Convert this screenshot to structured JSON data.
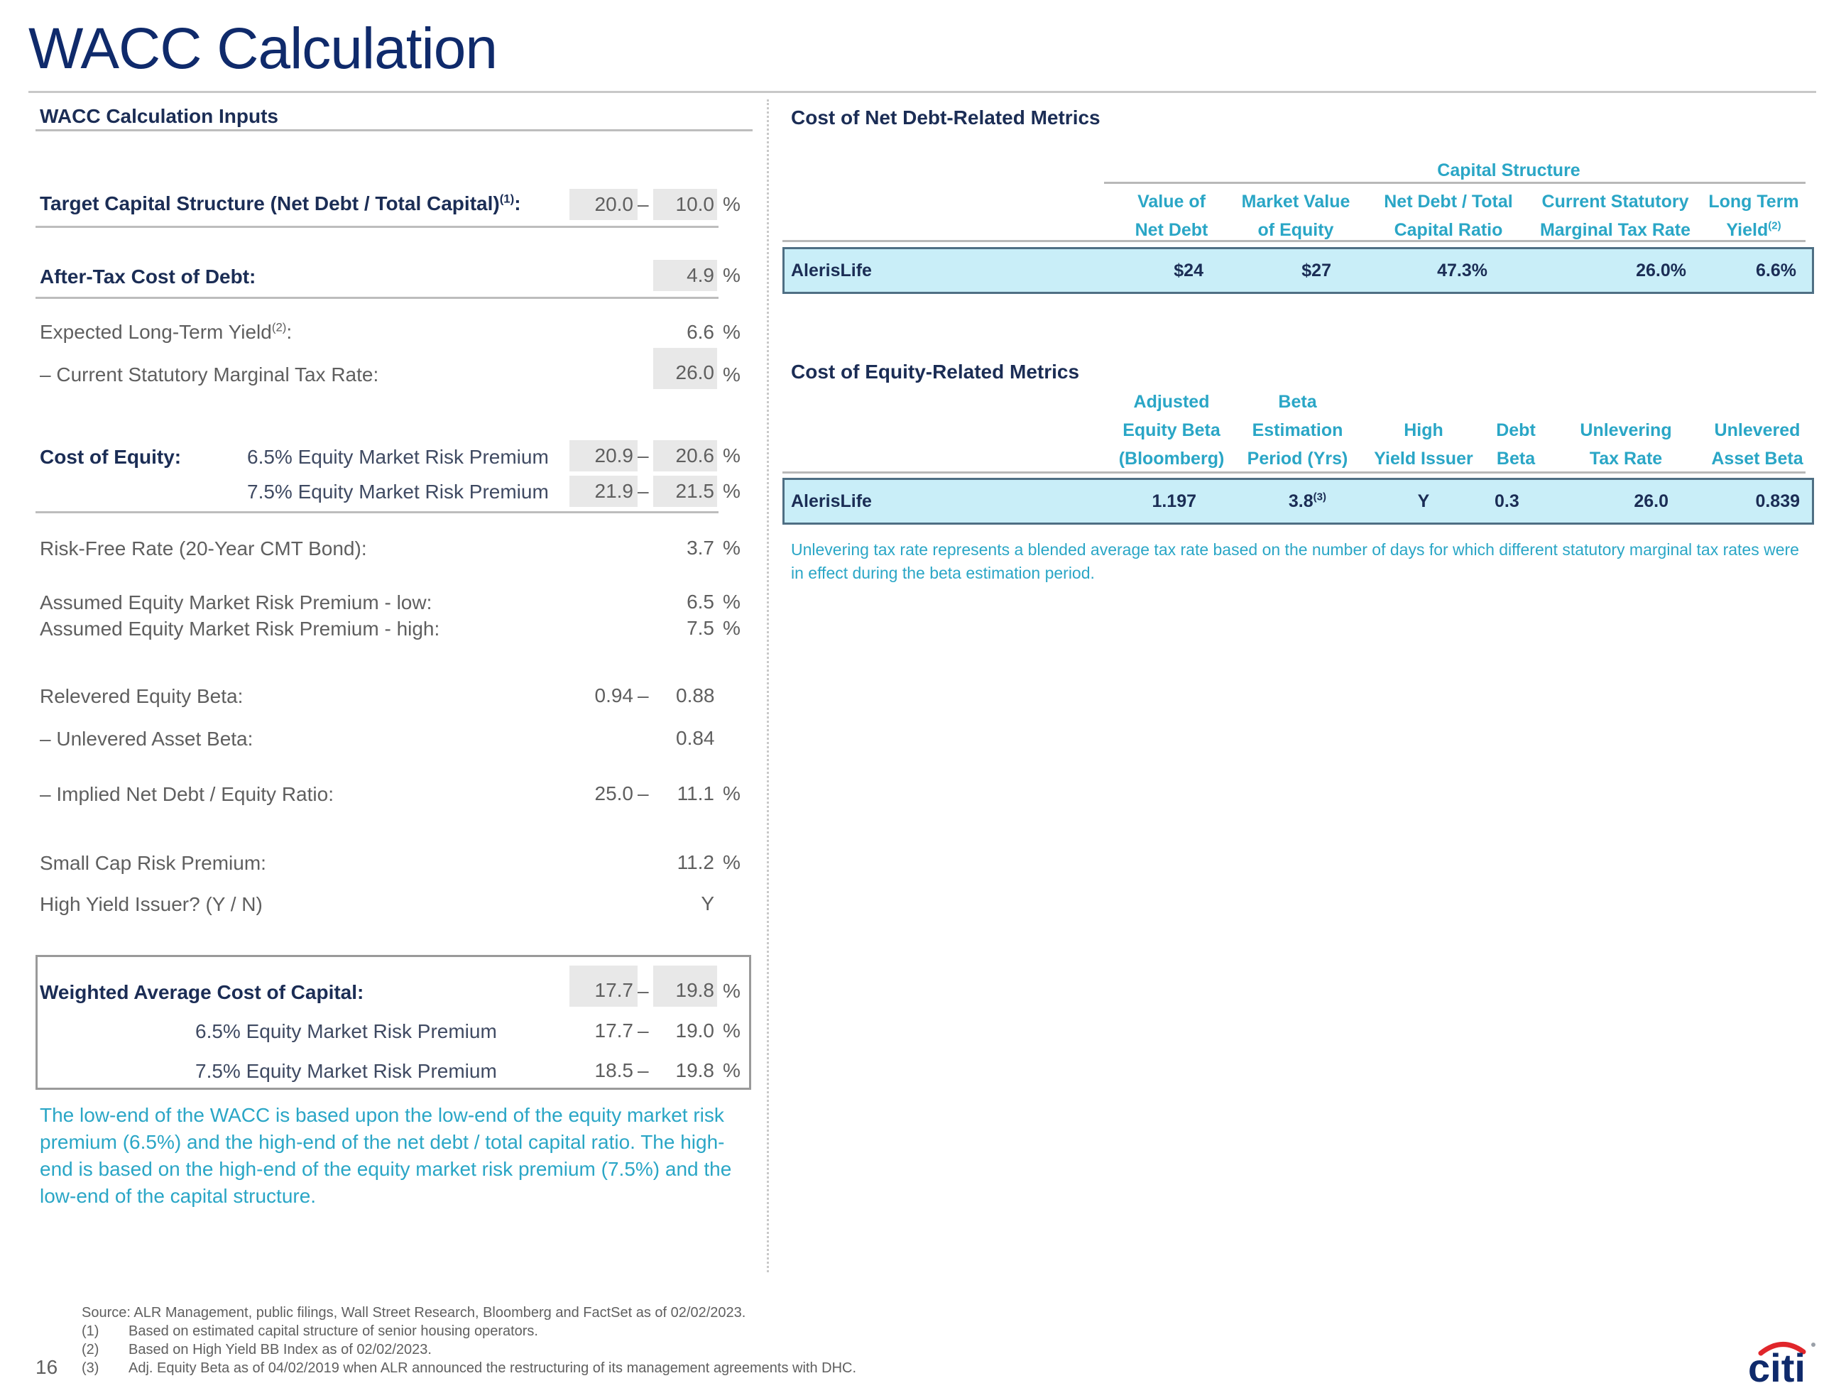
{
  "page": {
    "title": "WACC Calculation",
    "page_number": "16"
  },
  "inputs": {
    "section_title": "WACC Calculation Inputs",
    "target_capital": {
      "label": "Target Capital Structure (Net Debt / Total Capital)",
      "footnote": "(1)",
      "suffix": ":",
      "low": "20.0",
      "high": "10.0",
      "unit": "%"
    },
    "after_tax_cost_of_debt": {
      "label": "After-Tax Cost of Debt:",
      "value": "4.9",
      "unit": "%"
    },
    "expected_yield": {
      "label": "Expected Long-Term Yield",
      "footnote": "(2)",
      "suffix": ":",
      "value": "6.6",
      "unit": "%"
    },
    "marginal_tax": {
      "label": "– Current Statutory Marginal Tax Rate:",
      "value": "26.0",
      "unit": "%"
    },
    "cost_of_equity": {
      "label": "Cost of Equity:",
      "rows": [
        {
          "label": "6.5% Equity Market Risk Premium",
          "low": "20.9",
          "high": "20.6",
          "unit": "%"
        },
        {
          "label": "7.5% Equity Market Risk Premium",
          "low": "21.9",
          "high": "21.5",
          "unit": "%"
        }
      ]
    },
    "risk_free": {
      "label": "Risk-Free Rate (20-Year CMT Bond):",
      "value": "3.7",
      "unit": "%"
    },
    "erp_low": {
      "label": "Assumed Equity Market Risk Premium - low:",
      "value": "6.5",
      "unit": "%"
    },
    "erp_high": {
      "label": "Assumed Equity Market Risk Premium - high:",
      "value": "7.5",
      "unit": "%"
    },
    "relevered_beta": {
      "label": "Relevered Equity Beta:",
      "low": "0.94",
      "high": "0.88"
    },
    "unlevered_beta": {
      "label": "– Unlevered Asset Beta:",
      "value": "0.84"
    },
    "implied_ratio": {
      "label": "– Implied Net Debt / Equity Ratio:",
      "low": "25.0",
      "high": "11.1",
      "unit": "%"
    },
    "small_cap": {
      "label": "Small Cap Risk Premium:",
      "value": "11.2",
      "unit": "%"
    },
    "high_yield": {
      "label": "High Yield Issuer? (Y / N)",
      "value": "Y"
    },
    "dash": "–"
  },
  "wacc": {
    "label": "Weighted Average Cost of Capital:",
    "low": "17.7",
    "high": "19.8",
    "unit": "%",
    "rows": [
      {
        "label": "6.5% Equity Market Risk Premium",
        "low": "17.7",
        "high": "19.0",
        "unit": "%"
      },
      {
        "label": "7.5% Equity Market Risk Premium",
        "low": "18.5",
        "high": "19.8",
        "unit": "%"
      }
    ],
    "note": "The low-end of the WACC is based upon the low-end of the equity market risk premium (6.5%) and the high-end of the net debt / total capital ratio. The high-end is based on the high-end of the equity market risk premium (7.5%) and the low-end of the capital structure."
  },
  "debt_metrics": {
    "section_title": "Cost of Net Debt-Related Metrics",
    "group_header": "Capital Structure",
    "columns": [
      {
        "line1": "Value of",
        "line2": "Net Debt"
      },
      {
        "line1": "Market Value",
        "line2": "of Equity"
      },
      {
        "line1": "Net Debt / Total",
        "line2": "Capital Ratio"
      },
      {
        "line1": "Current Statutory",
        "line2": "Marginal Tax Rate"
      },
      {
        "line1": "Long Term",
        "line2": "Yield",
        "footnote": "(2)"
      }
    ],
    "row": {
      "name": "AlerisLife",
      "values": [
        "$24",
        "$27",
        "47.3%",
        "26.0%",
        "6.6%"
      ]
    }
  },
  "equity_metrics": {
    "section_title": "Cost of Equity-Related Metrics",
    "columns": [
      {
        "line1": "Adjusted",
        "line2": "Equity Beta",
        "line3": "(Bloomberg)"
      },
      {
        "line1": "Beta",
        "line2": "Estimation",
        "line3": "Period (Yrs)"
      },
      {
        "line1": "",
        "line2": "High",
        "line3": "Yield Issuer"
      },
      {
        "line1": "",
        "line2": "Debt",
        "line3": "Beta"
      },
      {
        "line1": "",
        "line2": "Unlevering",
        "line3": "Tax Rate"
      },
      {
        "line1": "",
        "line2": "Unlevered",
        "line3": "Asset Beta"
      }
    ],
    "row": {
      "name": "AlerisLife",
      "values": [
        "1.197",
        "3.8",
        "Y",
        "0.3",
        "26.0",
        "0.839"
      ],
      "period_footnote": "(3)"
    },
    "note": "Unlevering tax rate represents a blended average tax rate based on the number of days for which different statutory marginal tax rates were in effect during the beta estimation period."
  },
  "footer": {
    "source": "Source: ALR Management, public filings, Wall Street Research, Bloomberg and FactSet as of 02/02/2023.",
    "notes": [
      {
        "num": "(1)",
        "text": "Based on estimated capital structure of senior housing operators."
      },
      {
        "num": "(2)",
        "text": "Based on High Yield BB Index as of 02/02/2023."
      },
      {
        "num": "(3)",
        "text": "Adj. Equity Beta as of 04/02/2019 when ALR announced the restructuring of its management agreements with DHC."
      }
    ]
  },
  "brand": {
    "logo_text": "citi",
    "logo_icon": "citi-arc-logo",
    "colors": {
      "navy": "#0f2a6b",
      "red": "#e0262b",
      "teal": "#2aa6c6",
      "highlight": "#c9eef8"
    }
  }
}
